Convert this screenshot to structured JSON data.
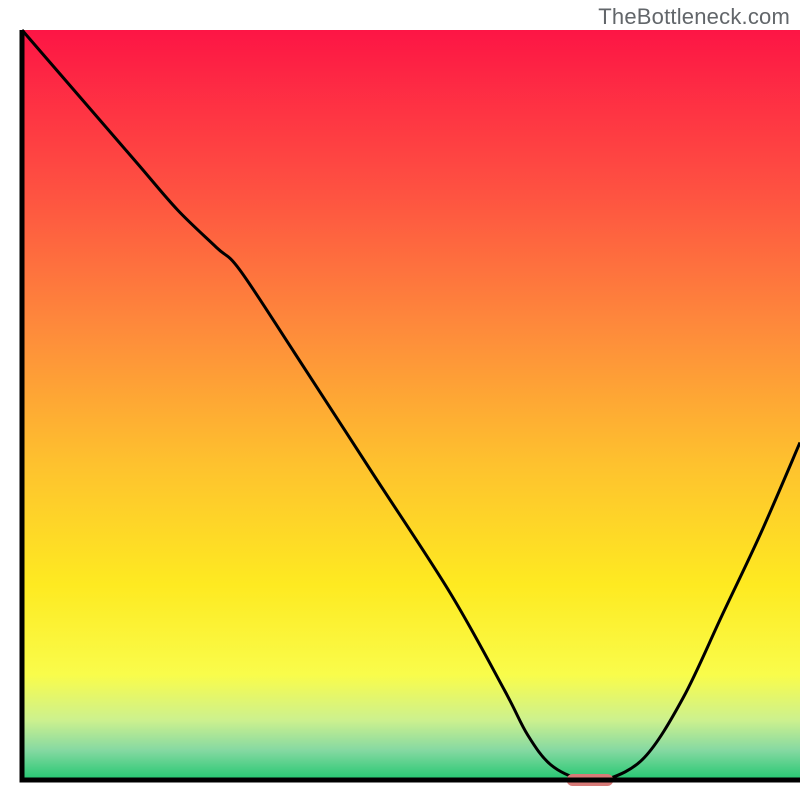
{
  "watermark": "TheBottleneck.com",
  "chart_data": {
    "type": "line",
    "title": "",
    "xlabel": "",
    "ylabel": "",
    "xlim": [
      0,
      100
    ],
    "ylim": [
      0,
      100
    ],
    "x": [
      0,
      5,
      10,
      15,
      20,
      25,
      28,
      35,
      45,
      55,
      62,
      65,
      68,
      72,
      75,
      80,
      85,
      90,
      95,
      100
    ],
    "y": [
      100,
      94,
      88,
      82,
      76,
      71,
      68,
      57,
      41,
      25,
      12,
      6,
      2,
      0,
      0,
      3,
      11,
      22,
      33,
      45
    ],
    "marker": {
      "x_range": [
        70,
        76
      ],
      "y": 0,
      "color": "#d77a77"
    },
    "background_gradient": {
      "stops": [
        {
          "offset": 0.0,
          "color": "#fd1545"
        },
        {
          "offset": 0.22,
          "color": "#fe5341"
        },
        {
          "offset": 0.4,
          "color": "#fe8b3b"
        },
        {
          "offset": 0.58,
          "color": "#fec22e"
        },
        {
          "offset": 0.74,
          "color": "#feea21"
        },
        {
          "offset": 0.86,
          "color": "#f9fc4b"
        },
        {
          "offset": 0.92,
          "color": "#cdf18e"
        },
        {
          "offset": 0.96,
          "color": "#86d9a2"
        },
        {
          "offset": 1.0,
          "color": "#23c771"
        }
      ]
    },
    "axis_color": "#000000",
    "axis_width": 5,
    "curve_color": "#000000",
    "curve_width": 3
  }
}
